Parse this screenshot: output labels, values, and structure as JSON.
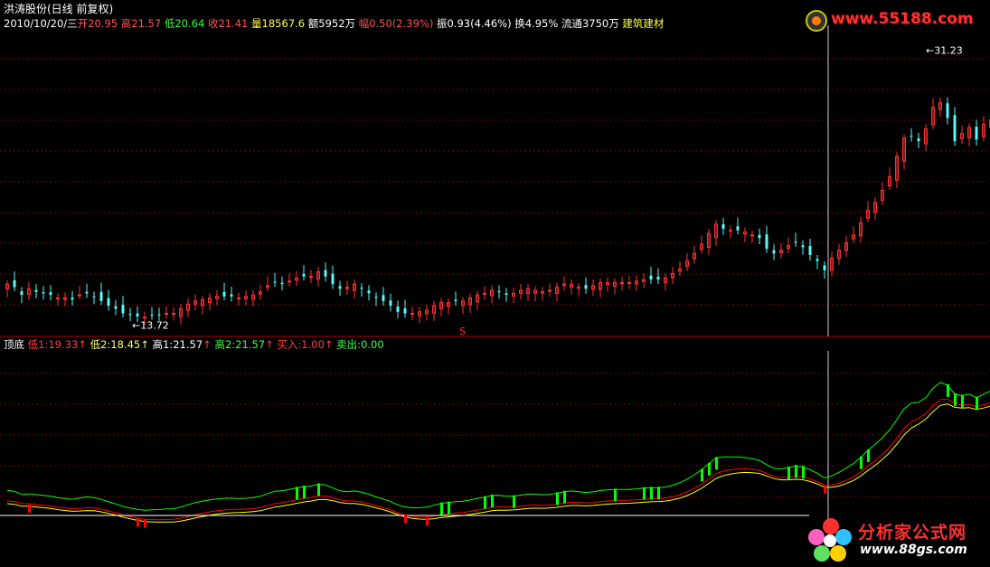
{
  "header": {
    "title": "洪涛股份(日线 前复权)",
    "date": "2010/10/20/三",
    "open_label": "开",
    "open": "20.95",
    "high_label": "高",
    "high": "21.57",
    "low_label": "低",
    "low": "20.64",
    "close_label": "收",
    "close": "21.41",
    "vol_label": "量",
    "vol": "18567.6",
    "amount_label": "额",
    "amount": "5952万",
    "change_label": "幅",
    "change": "0.50(2.39%)",
    "amp_label": "振",
    "amp": "0.93(4.46%)",
    "turnover_label": "换",
    "turnover": "4.95%",
    "float_label": "流通",
    "float": "3750万",
    "sector": "建筑建材"
  },
  "indicator": {
    "name": "顶底",
    "low1_label": "低1:",
    "low1": "19.33",
    "low2_label": "低2:",
    "low2": "18.45",
    "high1_label": "高1:",
    "high1": "21.57",
    "high2_label": "高2:",
    "high2": "21.57",
    "buy_label": "买入:",
    "buy": "1.00",
    "sell_label": "卖出:",
    "sell": "0.00"
  },
  "annotations": {
    "max_label": "31.23",
    "min_label": "13.72",
    "s_marker": "S"
  },
  "logos": {
    "top_url": "www.55188.com",
    "bottom_title": "分析家公式网",
    "bottom_url": "www.88gs.com"
  },
  "colors": {
    "up": "#ff3232",
    "down": "#54fcfc",
    "grid": "#800000",
    "green": "#00ff00",
    "yellow": "#ffff00",
    "red": "#ff0000",
    "white": "#ffffff"
  },
  "chart_data": [
    {
      "type": "candlestick",
      "title": "",
      "ylim": [
        12.5,
        32.5
      ],
      "grid": true,
      "points": [
        [
          0,
          15.9
        ],
        [
          8,
          15.7
        ],
        [
          16,
          15.2
        ],
        [
          24,
          15.6
        ],
        [
          32,
          15.4
        ],
        [
          40,
          15.3
        ],
        [
          48,
          15.2
        ],
        [
          56,
          15.0
        ],
        [
          64,
          15.0
        ],
        [
          72,
          14.9
        ],
        [
          80,
          15.2
        ],
        [
          88,
          15.3
        ],
        [
          96,
          15.1
        ],
        [
          104,
          14.8
        ],
        [
          112,
          14.5
        ],
        [
          120,
          14.3
        ],
        [
          128,
          14.0
        ],
        [
          136,
          13.9
        ],
        [
          144,
          13.8
        ],
        [
          152,
          13.75
        ],
        [
          160,
          13.9
        ],
        [
          168,
          13.9
        ],
        [
          176,
          14.0
        ],
        [
          184,
          14.0
        ],
        [
          192,
          14.3
        ],
        [
          200,
          14.6
        ],
        [
          208,
          14.8
        ],
        [
          216,
          14.9
        ],
        [
          224,
          15.0
        ],
        [
          232,
          15.1
        ],
        [
          240,
          15.1
        ],
        [
          248,
          15.1
        ],
        [
          256,
          15.0
        ],
        [
          264,
          15.1
        ],
        [
          272,
          15.2
        ],
        [
          280,
          15.4
        ],
        [
          288,
          15.8
        ],
        [
          296,
          16.0
        ],
        [
          304,
          15.9
        ],
        [
          312,
          16.1
        ],
        [
          320,
          16.3
        ],
        [
          328,
          16.4
        ],
        [
          336,
          16.4
        ],
        [
          344,
          16.7
        ],
        [
          352,
          16.4
        ],
        [
          360,
          15.9
        ],
        [
          368,
          15.6
        ],
        [
          376,
          15.7
        ],
        [
          384,
          15.9
        ],
        [
          392,
          15.6
        ],
        [
          400,
          15.3
        ],
        [
          408,
          15.0
        ],
        [
          416,
          14.8
        ],
        [
          424,
          14.5
        ],
        [
          432,
          14.1
        ],
        [
          440,
          14.0
        ],
        [
          448,
          14.0
        ],
        [
          456,
          14.1
        ],
        [
          464,
          14.2
        ],
        [
          472,
          14.5
        ],
        [
          480,
          14.7
        ],
        [
          488,
          14.7
        ],
        [
          496,
          14.8
        ],
        [
          504,
          14.8
        ],
        [
          512,
          15.0
        ],
        [
          520,
          15.2
        ],
        [
          528,
          15.3
        ],
        [
          536,
          15.5
        ],
        [
          544,
          15.4
        ],
        [
          552,
          15.2
        ],
        [
          560,
          15.3
        ],
        [
          568,
          15.5
        ],
        [
          576,
          15.6
        ],
        [
          584,
          15.5
        ],
        [
          592,
          15.4
        ],
        [
          600,
          15.5
        ],
        [
          608,
          15.7
        ],
        [
          616,
          15.9
        ],
        [
          624,
          15.9
        ],
        [
          632,
          15.7
        ],
        [
          640,
          15.6
        ],
        [
          648,
          15.8
        ],
        [
          656,
          16.0
        ],
        [
          664,
          16.0
        ],
        [
          672,
          16.0
        ],
        [
          680,
          16.0
        ],
        [
          688,
          16.0
        ],
        [
          696,
          16.1
        ],
        [
          704,
          16.2
        ],
        [
          712,
          16.2
        ],
        [
          720,
          16.2
        ],
        [
          728,
          16.3
        ],
        [
          736,
          16.6
        ],
        [
          744,
          16.9
        ],
        [
          752,
          17.4
        ],
        [
          760,
          17.9
        ],
        [
          768,
          18.5
        ],
        [
          776,
          19.2
        ],
        [
          784,
          19.8
        ],
        [
          792,
          19.5
        ],
        [
          800,
          19.4
        ],
        [
          808,
          19.4
        ],
        [
          816,
          19.3
        ],
        [
          824,
          19.1
        ],
        [
          832,
          18.9
        ],
        [
          840,
          18.2
        ],
        [
          848,
          17.9
        ],
        [
          856,
          18.1
        ],
        [
          864,
          18.4
        ],
        [
          872,
          18.6
        ],
        [
          880,
          18.3
        ],
        [
          888,
          17.8
        ],
        [
          896,
          17.4
        ],
        [
          904,
          16.8
        ],
        [
          912,
          17.6
        ],
        [
          920,
          18.1
        ],
        [
          928,
          18.6
        ],
        [
          936,
          19.1
        ],
        [
          944,
          19.9
        ],
        [
          952,
          20.7
        ],
        [
          960,
          21.2
        ],
        [
          968,
          22.0
        ],
        [
          976,
          22.9
        ],
        [
          984,
          24.2
        ],
        [
          992,
          25.4
        ],
        [
          1000,
          25.5
        ],
        [
          1008,
          25.2
        ],
        [
          1016,
          26.0
        ],
        [
          1024,
          27.4
        ],
        [
          1032,
          27.7
        ],
        [
          1040,
          26.7
        ],
        [
          1048,
          25.2
        ],
        [
          1056,
          25.7
        ],
        [
          1064,
          26.1
        ],
        [
          1072,
          25.3
        ],
        [
          1080,
          26.3
        ],
        [
          1088,
          26.6
        ]
      ]
    },
    {
      "type": "line",
      "title": "",
      "series": [
        {
          "name": "低1",
          "values": []
        },
        {
          "name": "低2",
          "values": []
        },
        {
          "name": "高1",
          "values": []
        },
        {
          "name": "高2",
          "values": []
        },
        {
          "name": "买入",
          "values": []
        },
        {
          "name": "卖出",
          "values": []
        }
      ]
    }
  ]
}
